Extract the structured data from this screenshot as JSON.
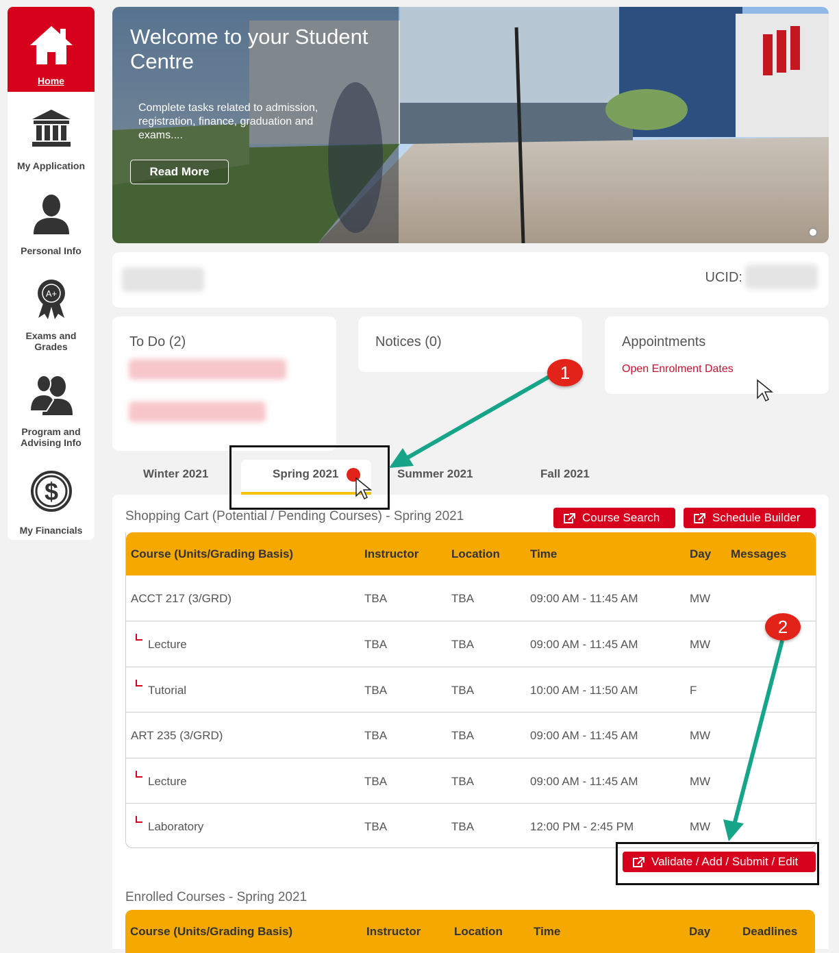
{
  "sidebar": {
    "items": [
      {
        "label": "Home",
        "icon": "home-icon",
        "active": true
      },
      {
        "label": "My Application",
        "icon": "institution-icon"
      },
      {
        "label": "Personal Info",
        "icon": "person-icon"
      },
      {
        "label": "Exams and Grades",
        "icon": "award-ribbon-icon",
        "badge_text": "A+"
      },
      {
        "label": "Program and Advising Info",
        "icon": "advisor-icon"
      },
      {
        "label": "My Financials",
        "icon": "dollar-circle-icon",
        "symbol": "$"
      }
    ]
  },
  "hero": {
    "title": "Welcome to your Student Centre",
    "text": "Complete tasks related to admission, registration, finance, graduation and exams....",
    "button": "Read More"
  },
  "info": {
    "ucid_label": "UCID:"
  },
  "cards": {
    "todo": "To Do (2)",
    "notices": "Notices (0)",
    "appointments": "Appointments",
    "appointments_link": "Open Enrolment Dates"
  },
  "terms": [
    "Winter 2021",
    "Spring 2021",
    "Summer 2021",
    "Fall 2021"
  ],
  "active_term": "Spring 2021",
  "cart": {
    "title": "Shopping Cart (Potential / Pending Courses) - Spring 2021",
    "course_search": "Course Search",
    "schedule_builder": "Schedule Builder",
    "headers": [
      "Course (Units/Grading Basis)",
      "Instructor",
      "Location",
      "Time",
      "Day",
      "Messages"
    ],
    "rows": [
      {
        "course": "ACCT 217 (3/GRD)",
        "instructor": "TBA",
        "location": "TBA",
        "time": "09:00 AM - 11:45 AM",
        "day": "MW",
        "sub": false
      },
      {
        "course": "Lecture",
        "instructor": "TBA",
        "location": "TBA",
        "time": "09:00 AM - 11:45 AM",
        "day": "MW",
        "sub": true
      },
      {
        "course": "Tutorial",
        "instructor": "TBA",
        "location": "TBA",
        "time": "10:00 AM - 11:50 AM",
        "day": "F",
        "sub": true
      },
      {
        "course": "ART 235 (3/GRD)",
        "instructor": "TBA",
        "location": "TBA",
        "time": "09:00 AM - 11:45 AM",
        "day": "MW",
        "sub": false
      },
      {
        "course": "Lecture",
        "instructor": "TBA",
        "location": "TBA",
        "time": "09:00 AM - 11:45 AM",
        "day": "MW",
        "sub": true
      },
      {
        "course": "Laboratory",
        "instructor": "TBA",
        "location": "TBA",
        "time": "12:00 PM - 2:45 PM",
        "day": "MW",
        "sub": true
      }
    ],
    "validate_button": "Validate / Add / Submit / Edit"
  },
  "enrolled": {
    "title": "Enrolled Courses - Spring 2021",
    "headers": [
      "Course (Units/Grading Basis)",
      "Instructor",
      "Location",
      "Time",
      "Day",
      "Deadlines"
    ]
  },
  "annotations": {
    "step1": "1",
    "step2": "2"
  },
  "colors": {
    "brand_red": "#d6001c",
    "table_header": "#f5a800",
    "tab_underline": "#f4c20d",
    "arrow": "#17a589"
  }
}
